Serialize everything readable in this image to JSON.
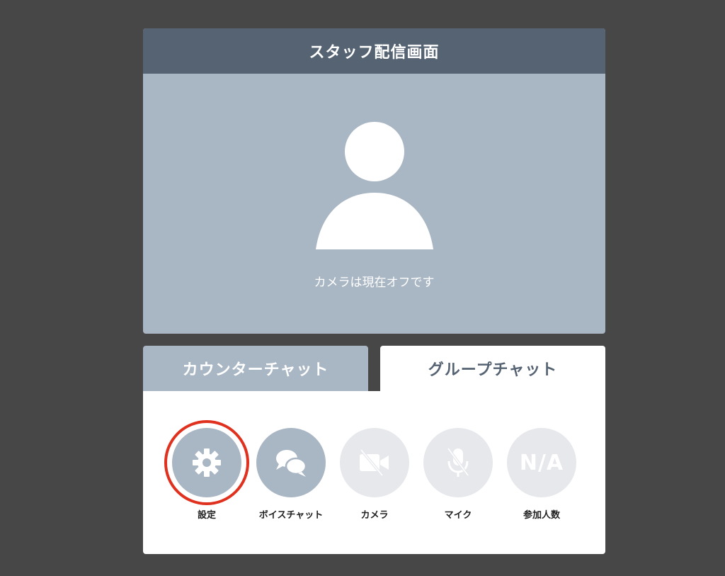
{
  "video": {
    "title": "スタッフ配信画面",
    "camera_status": "カメラは現在オフです"
  },
  "tabs": [
    {
      "label": "カウンターチャット",
      "selected": false
    },
    {
      "label": "グループチャット",
      "selected": true
    }
  ],
  "controls": [
    {
      "label": "設定",
      "icon": "gear-icon",
      "state": "active",
      "highlighted": true
    },
    {
      "label": "ボイスチャット",
      "icon": "chat-bubbles-icon",
      "state": "active"
    },
    {
      "label": "カメラ",
      "icon": "camera-off-icon",
      "state": "disabled"
    },
    {
      "label": "マイク",
      "icon": "mic-off-icon",
      "state": "disabled"
    },
    {
      "label": "参加人数",
      "icon": "na-text",
      "value": "N/A",
      "state": "disabled"
    }
  ],
  "colors": {
    "background": "#474747",
    "header": "#566373",
    "video_bg": "#a9b6c4",
    "active_button": "#a9b6c4",
    "disabled_button": "#e6e8ec",
    "highlight_ring": "#e0301e"
  }
}
